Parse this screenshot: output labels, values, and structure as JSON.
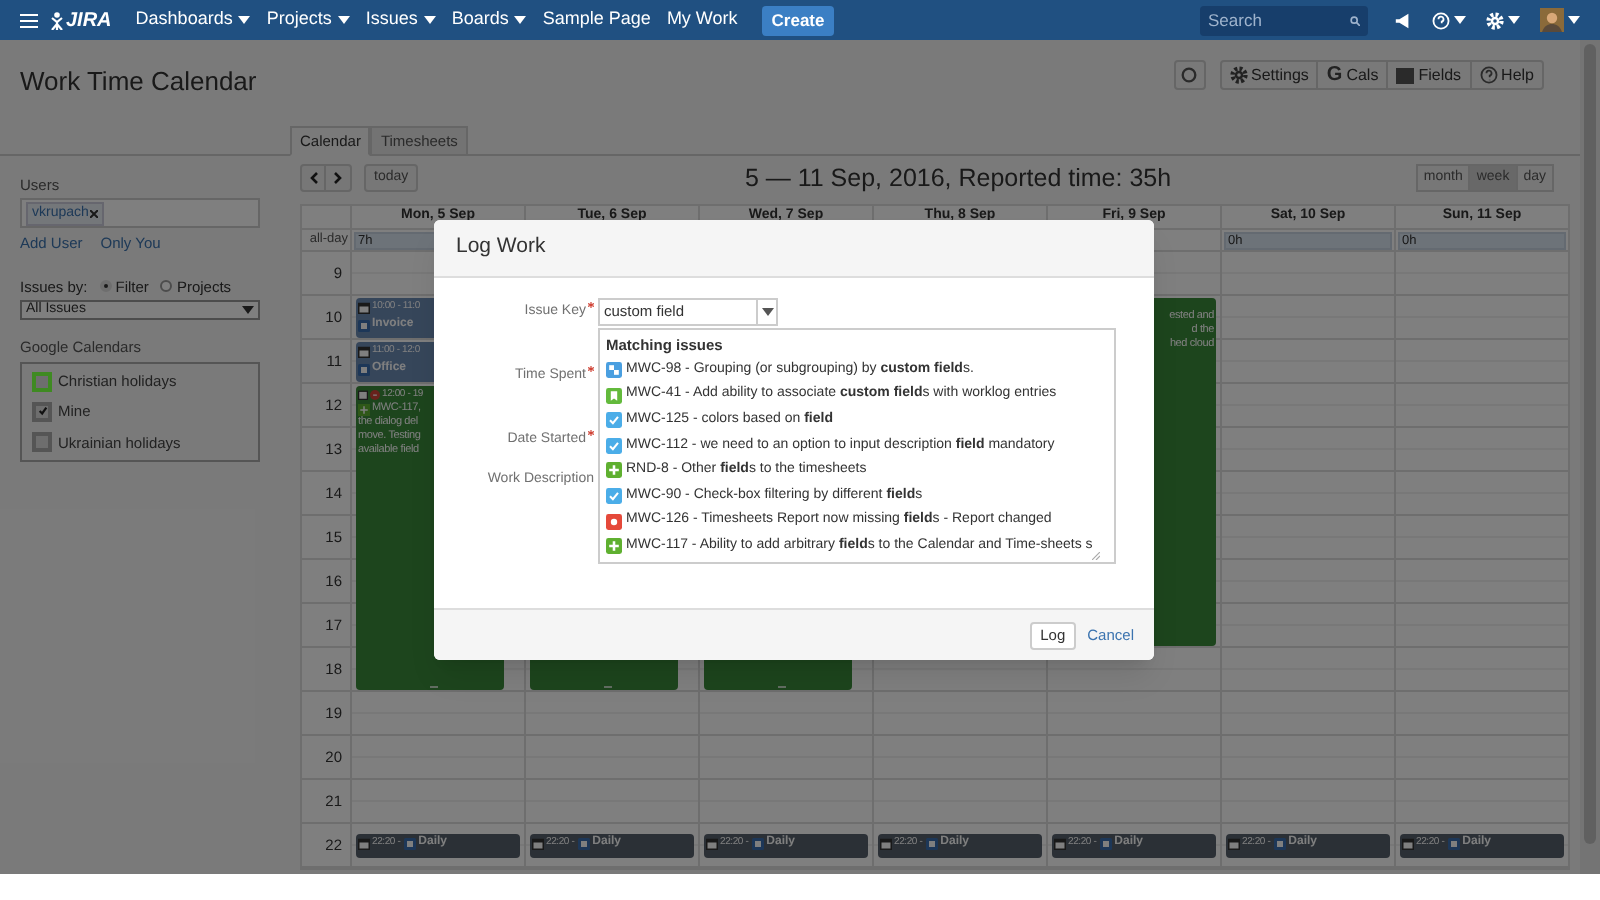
{
  "nav": {
    "logo": "JIRA",
    "items": [
      {
        "label": "Dashboards",
        "dropdown": true
      },
      {
        "label": "Projects",
        "dropdown": true
      },
      {
        "label": "Issues",
        "dropdown": true
      },
      {
        "label": "Boards",
        "dropdown": true
      },
      {
        "label": "Sample Page",
        "dropdown": false
      },
      {
        "label": "My Work",
        "dropdown": false
      }
    ],
    "create": "Create",
    "search": {
      "placeholder": "Search"
    }
  },
  "page": {
    "title": "Work Time Calendar",
    "toolbar": [
      {
        "kind": "refresh"
      },
      {
        "kind": "settings",
        "label": "Settings"
      },
      {
        "kind": "google",
        "label": "Cals",
        "glyph": "G"
      },
      {
        "kind": "fields",
        "label": "Fields"
      },
      {
        "kind": "help",
        "label": "Help"
      }
    ],
    "tabs": [
      {
        "label": "Calendar",
        "selected": true
      },
      {
        "label": "Timesheets",
        "selected": false
      }
    ]
  },
  "sidebar": {
    "users_label": "Users",
    "user_tag": "vkrupach",
    "links": [
      "Add User",
      "Only You"
    ],
    "issues_by_label": "Issues by:",
    "issues_by": [
      {
        "label": "Filter",
        "selected": true
      },
      {
        "label": "Projects",
        "selected": false
      }
    ],
    "filter": "All Issues",
    "calendars_label": "Google Calendars",
    "calendars": [
      {
        "label": "Christian holidays",
        "checked": false,
        "color": "#3f8a22"
      },
      {
        "label": "Mine",
        "checked": true,
        "color": "#555555"
      },
      {
        "label": "Ukrainian holidays",
        "checked": false,
        "color": "#555555"
      }
    ]
  },
  "calendar": {
    "title": "5 — 11 Sep, 2016, Reported time: 35h",
    "today": "today",
    "views": [
      {
        "label": "month",
        "selected": false
      },
      {
        "label": "week",
        "selected": true
      },
      {
        "label": "day",
        "selected": false
      }
    ],
    "allday_label": "all-day",
    "hours": [
      "9",
      "10",
      "11",
      "12",
      "13",
      "14",
      "15",
      "16",
      "17",
      "18",
      "19",
      "20",
      "21",
      "22"
    ],
    "days": [
      {
        "header": "Mon, 5 Sep",
        "total": "7h",
        "events": [
          {
            "kind": "meeting",
            "time": "10:00 - 11:0",
            "title": "Invoice"
          },
          {
            "kind": "meeting",
            "time": "11:00 - 12:0",
            "title": "Office"
          },
          {
            "kind": "work",
            "time": "12:00 - 19",
            "lines": [
              "MWC-117,",
              "the dialog del",
              "move. Testing",
              "available field"
            ]
          },
          {
            "kind": "daily",
            "time": "22:20 -",
            "title": "Daily"
          }
        ]
      },
      {
        "header": "Tue, 6 Sep",
        "events": [
          {
            "kind": "work"
          },
          {
            "kind": "daily",
            "time": "22:20 -",
            "title": "Daily"
          }
        ]
      },
      {
        "header": "Wed, 7 Sep",
        "events": [
          {
            "kind": "work"
          },
          {
            "kind": "daily",
            "time": "22:20 -",
            "title": "Daily"
          }
        ]
      },
      {
        "header": "Thu, 8 Sep",
        "events": [
          {
            "kind": "daily",
            "time": "22:20 -",
            "title": "Daily"
          }
        ]
      },
      {
        "header": "Fri, 9 Sep",
        "events": [
          {
            "kind": "work",
            "lines": [
              "ested and",
              "d the",
              "hed cloud"
            ]
          },
          {
            "kind": "daily",
            "time": "22:20 -",
            "title": "Daily"
          }
        ]
      },
      {
        "header": "Sat, 10 Sep",
        "total": "0h",
        "events": [
          {
            "kind": "daily",
            "time": "22:20 -",
            "title": "Daily"
          }
        ]
      },
      {
        "header": "Sun, 11 Sep",
        "total": "0h",
        "events": [
          {
            "kind": "daily",
            "time": "22:20 -",
            "title": "Daily"
          }
        ]
      }
    ]
  },
  "dialog": {
    "title": "Log Work",
    "fields": [
      {
        "label": "Issue Key",
        "required": true
      },
      {
        "label": "Time Spent",
        "required": true
      },
      {
        "label": "Date Started",
        "required": true
      },
      {
        "label": "Work Description",
        "required": false
      }
    ],
    "issue_key": "custom field",
    "suggestions_heading": "Matching issues",
    "suggestions": [
      {
        "kind": "subtask",
        "text": "MWC-98 - Grouping (or subgrouping) by **custom field**s."
      },
      {
        "kind": "story",
        "text": "MWC-41 - Add ability to associate **custom field**s with worklog entries"
      },
      {
        "kind": "task",
        "text": "MWC-125 - colors based on **field**"
      },
      {
        "kind": "task",
        "text": "MWC-112 - we need to an option to input description **field** mandatory"
      },
      {
        "kind": "feature",
        "text": "RND-8 - Other **field**s to the timesheets"
      },
      {
        "kind": "task",
        "text": "MWC-90 - Check-box filtering by different **field**s"
      },
      {
        "kind": "bug",
        "text": "MWC-126 - Timesheets Report now missing **field**s - Report changed"
      },
      {
        "kind": "feature",
        "text": "MWC-117 - Ability to add arbitrary **field**s to the Calendar and Time-sheets s"
      }
    ],
    "buttons": {
      "submit": "Log",
      "cancel": "Cancel"
    }
  }
}
